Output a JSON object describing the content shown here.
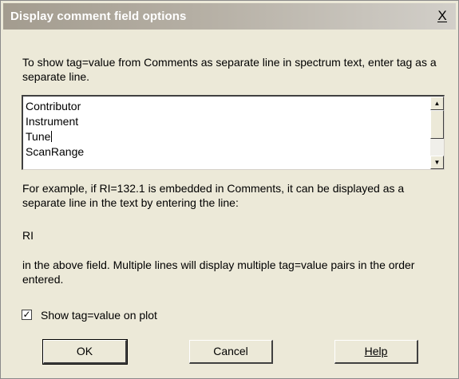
{
  "window": {
    "title": "Display comment field options",
    "close_label": "X"
  },
  "instructions": "To show tag=value from Comments as separate line in spectrum text, enter tag as a separate line.",
  "tag_list": {
    "lines": [
      "Contributor",
      "Instrument",
      "Tune",
      "ScanRange"
    ]
  },
  "scroll_up_glyph": "▲",
  "scroll_down_glyph": "▼",
  "example_text": "For example, if RI=132.1 is embedded in Comments, it can be displayed as a separate line in the text by entering the line:",
  "example_tag": "RI",
  "explanation_text": "in the above field. Multiple lines will display multiple tag=value pairs in the order entered.",
  "checkbox": {
    "label": "Show tag=value on plot",
    "checked": true,
    "check_glyph": "✓"
  },
  "buttons": {
    "ok": "OK",
    "cancel": "Cancel",
    "help": "Help"
  }
}
